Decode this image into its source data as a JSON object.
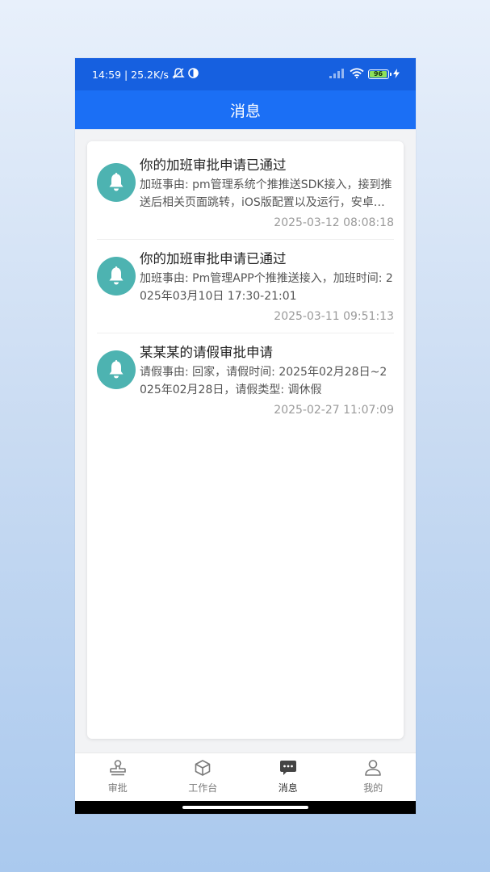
{
  "status_bar": {
    "time_speed": "14:59 | 25.2K/s",
    "battery": "96"
  },
  "header": {
    "title": "消息"
  },
  "messages": [
    {
      "title": "你的加班审批申请已通过",
      "desc": "加班事由: pm管理系统个推推送SDK接入，接到推送后相关页面跳转，iOS版配置以及运行，安卓版配置以及运行",
      "time": "2025-03-12 08:08:18",
      "icon": "bell-icon"
    },
    {
      "title": "你的加班审批申请已通过",
      "desc": "加班事由: Pm管理APP个推推送接入，加班时间: 2025年03月10日 17:30-21:01",
      "time": "2025-03-11 09:51:13",
      "icon": "bell-icon"
    },
    {
      "title": "某某某的请假审批申请",
      "desc": "请假事由: 回家，请假时间: 2025年02月28日~2025年02月28日，请假类型: 调休假",
      "time": "2025-02-27 11:07:09",
      "icon": "bell-icon"
    }
  ],
  "tabbar": {
    "items": [
      {
        "label": "审批",
        "icon": "stamp-icon"
      },
      {
        "label": "工作台",
        "icon": "cube-icon"
      },
      {
        "label": "消息",
        "icon": "message-icon",
        "active": true
      },
      {
        "label": "我的",
        "icon": "user-icon"
      }
    ]
  },
  "colors": {
    "status_bar": "#1660e0",
    "header": "#1b6ff5",
    "bell_bg": "#4db3b1"
  }
}
